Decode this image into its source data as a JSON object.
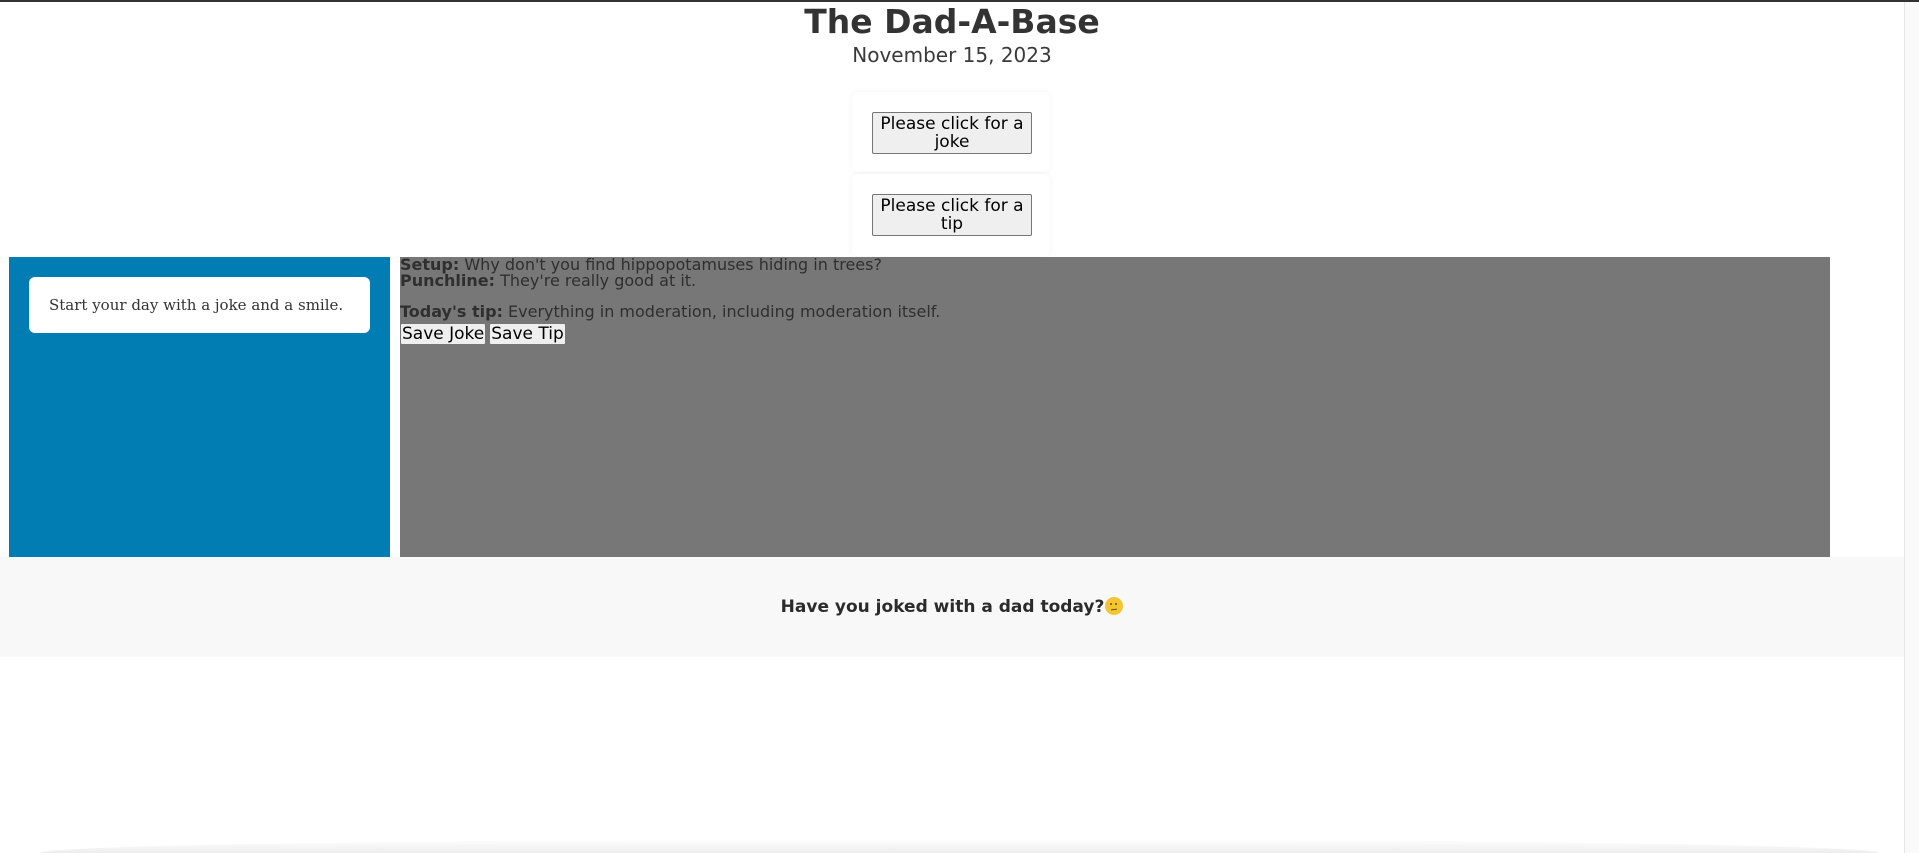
{
  "header": {
    "title": "The Dad-A-Base",
    "date": "November 15, 2023"
  },
  "actions": {
    "joke_button_label": "Please click for a joke",
    "tip_button_label": "Please click for a tip"
  },
  "sidebar": {
    "message": "Start your day with a joke and a smile."
  },
  "content": {
    "setup_label": "Setup:",
    "setup_text": " Why don't you find hippopotamuses hiding in trees?",
    "punchline_label": "Punchline:",
    "punchline_text": " They're really good at it.",
    "tip_label": "Today's tip:",
    "tip_text": " Everything in moderation, including moderation itself.",
    "save_joke_label": "Save Joke",
    "save_tip_label": "Save Tip"
  },
  "footer": {
    "text": "Have you joked with a dad today?",
    "icon": "thinking-face-icon"
  },
  "colors": {
    "sidebar_bg": "#027db3",
    "content_bg": "#777777",
    "footer_bg": "#f8f8f8"
  }
}
